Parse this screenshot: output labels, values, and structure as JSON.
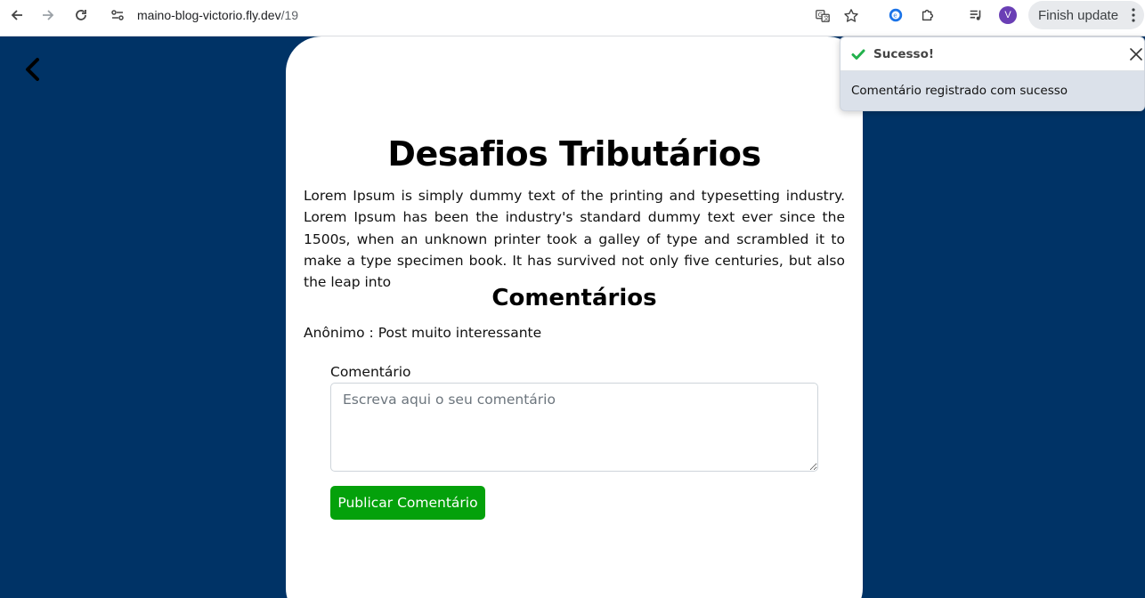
{
  "browser": {
    "url_domain": "maino-blog-victorio.fly.dev",
    "url_path": "/19",
    "avatar_letter": "V",
    "update_label": "Finish update"
  },
  "post": {
    "title": "Desafios Tributários",
    "body": "Lorem Ipsum is simply dummy text of the printing and typesetting industry. Lorem Ipsum has been the industry's standard dummy text ever since the 1500s, when an unknown printer took a galley of type and scrambled it to make a type specimen book. It has survived not only five centuries, but also the leap into"
  },
  "comments": {
    "heading": "Comentários",
    "items": [
      {
        "text": "Anônimo : Post muito interessante"
      }
    ]
  },
  "form": {
    "label": "Comentário",
    "placeholder": "Escreva aqui o seu comentário",
    "submit_label": "Publicar Comentário"
  },
  "toast": {
    "title": "Sucesso!",
    "message": "Comentário registrado com sucesso"
  },
  "colors": {
    "page_background": "#003366",
    "button_green": "#04a10b",
    "success_check": "#22b14c"
  },
  "icons": [
    "back-icon",
    "forward-icon",
    "reload-icon",
    "site-settings-icon",
    "translate-icon",
    "bookmark-star-icon",
    "extension-icon",
    "puzzle-icon",
    "media-icon",
    "menu-dots-icon",
    "chevron-left-icon",
    "check-icon",
    "close-icon"
  ]
}
